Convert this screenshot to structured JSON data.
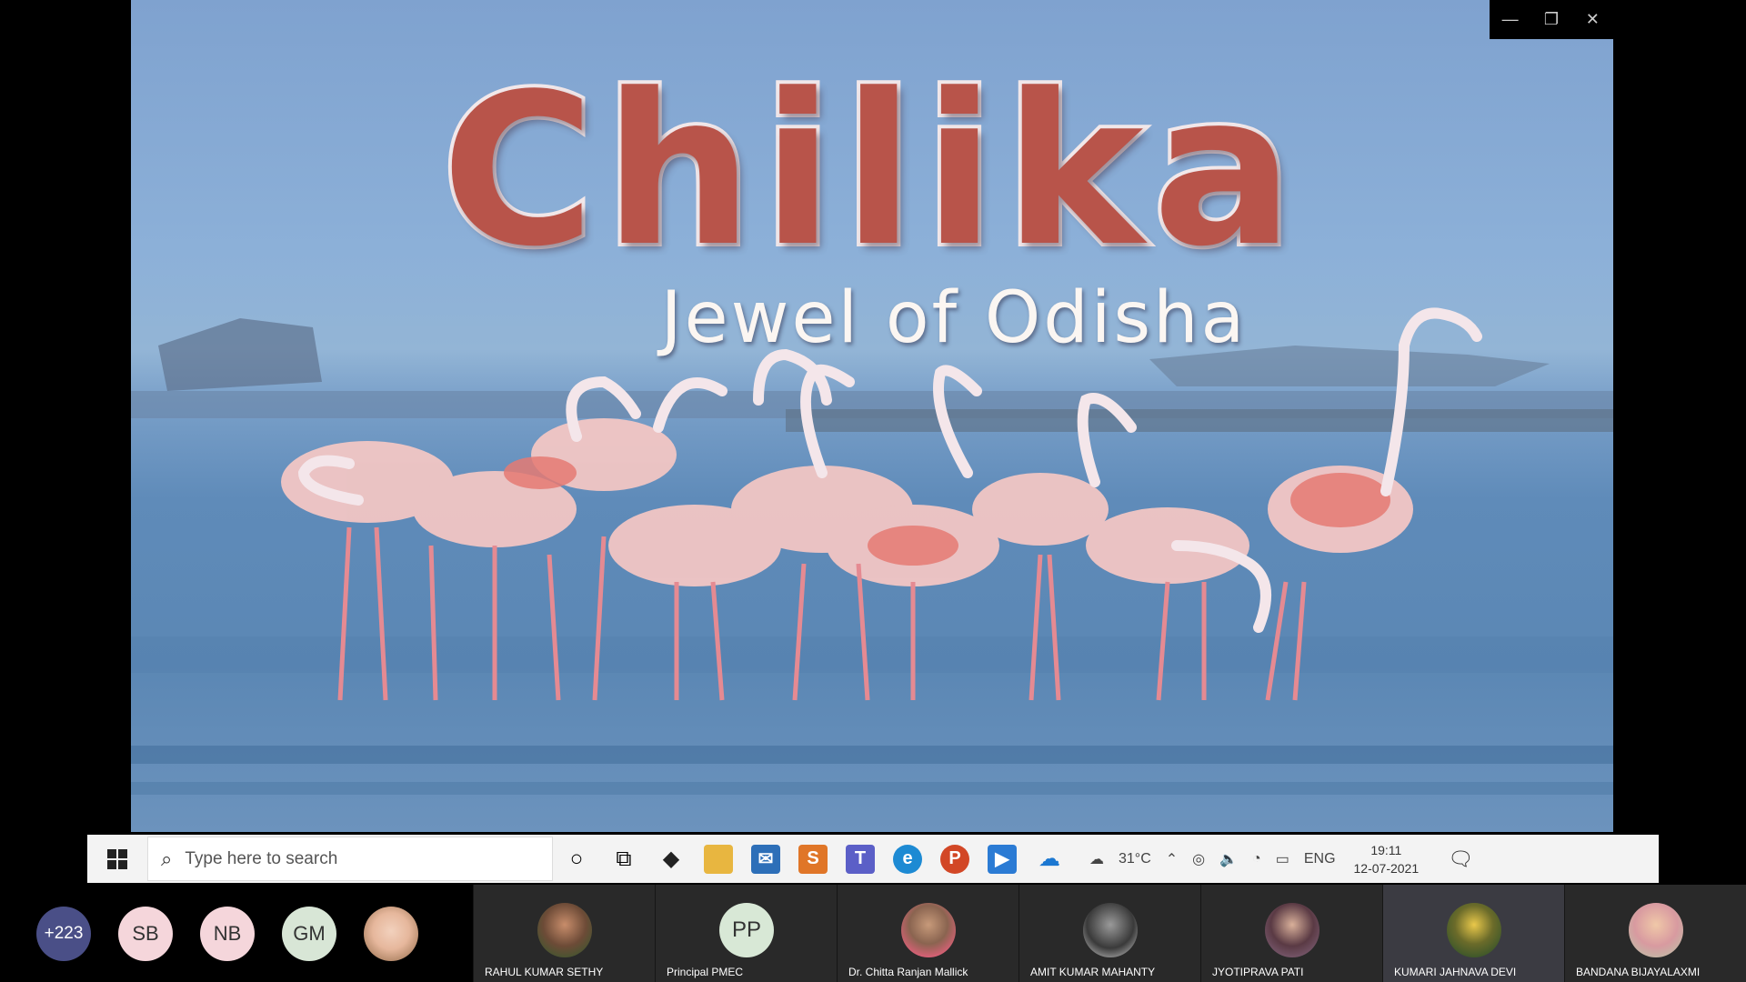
{
  "slide": {
    "title": "Chilika",
    "subtitle": "Jewel of Odisha"
  },
  "window_controls": {
    "minimize": "—",
    "restore": "❐",
    "close": "✕"
  },
  "taskbar": {
    "search_placeholder": "Type here to search",
    "weather": "31°C",
    "language": "ENG",
    "time": "19:11",
    "date": "12-07-2021",
    "apps": [
      "cortana-icon",
      "task-view-icon",
      "dropbox-icon",
      "file-explorer-icon",
      "mail-icon",
      "sway-icon",
      "teams-icon",
      "edge-icon",
      "powerpoint-icon",
      "media-app-icon",
      "onedrive-icon"
    ]
  },
  "participants": {
    "overflow": "+223",
    "small": [
      {
        "initials": "SB",
        "style": "pink"
      },
      {
        "initials": "NB",
        "style": "pink"
      },
      {
        "initials": "GM",
        "style": "green"
      },
      {
        "initials": "",
        "style": "photo"
      }
    ],
    "tiles": [
      {
        "name": "RAHUL KUMAR SETHY",
        "initials": ""
      },
      {
        "name": "Principal PMEC",
        "initials": "PP"
      },
      {
        "name": "Dr. Chitta Ranjan Mallick",
        "initials": ""
      },
      {
        "name": "AMIT KUMAR MAHANTY",
        "initials": ""
      },
      {
        "name": "JYOTIPRAVA PATI",
        "initials": ""
      },
      {
        "name": "KUMARI JAHNAVA DEVI",
        "initials": ""
      },
      {
        "name": "BANDANA BIJAYALAXMI",
        "initials": ""
      }
    ]
  }
}
